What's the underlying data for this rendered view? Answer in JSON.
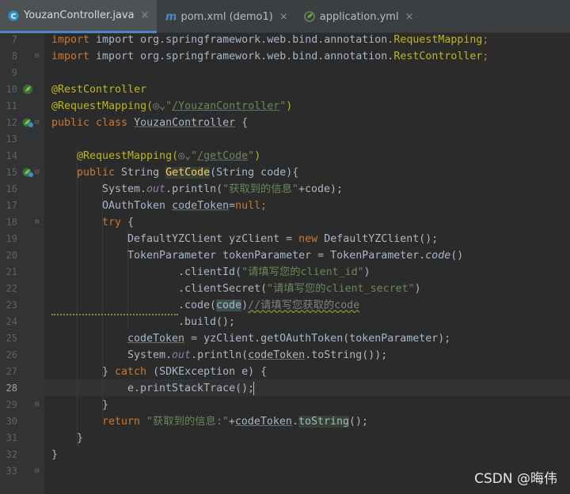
{
  "tabs": [
    {
      "label": "YouzanController.java",
      "icon": "java-class-icon",
      "active": true
    },
    {
      "label": "pom.xml (demo1)",
      "icon": "maven-icon",
      "active": false
    },
    {
      "label": "application.yml",
      "icon": "spring-config-icon",
      "active": false
    }
  ],
  "close_glyph": "×",
  "line_numbers": [
    "7",
    "8",
    "9",
    "10",
    "11",
    "12",
    "13",
    "14",
    "15",
    "16",
    "17",
    "18",
    "19",
    "20",
    "21",
    "22",
    "23",
    "24",
    "25",
    "26",
    "27",
    "28",
    "29",
    "30",
    "31",
    "32",
    "33"
  ],
  "current_line": "28",
  "code": {
    "l7": "import org.springframework.web.bind.annotation.",
    "l7b": "RequestMapping",
    "l7c": ";",
    "l8": "import org.springframework.web.bind.annotation.",
    "l8b": "RestController",
    "l8c": ";",
    "l10": "@RestController",
    "l11a": "@RequestMapping(",
    "l11b": "\"",
    "l11c": "/YouzanController",
    "l11d": "\"",
    "l11e": ")",
    "l12a": "public class ",
    "l12b": "YouzanController",
    "l12c": " {",
    "l14a": "@RequestMapping(",
    "l14b": "\"",
    "l14c": "/getCode",
    "l14d": "\"",
    "l14e": ")",
    "l15a": "public ",
    "l15b": "String ",
    "l15c": "GetCode",
    "l15d": "(String code){",
    "l16a": "System.",
    "l16b": "out",
    "l16c": ".println(",
    "l16d": "\"获取到的信息\"",
    "l16e": "+code);",
    "l17a": "OAuthToken ",
    "l17b": "codeToken",
    "l17c": "=",
    "l17d": "null",
    "l17e": ";",
    "l18a": "try",
    "l18b": " {",
    "l19a": "DefaultYZClient yzClient = ",
    "l19b": "new ",
    "l19c": "DefaultYZClient",
    "l19d": "();",
    "l20a": "TokenParameter tokenParameter = TokenParameter.",
    "l20b": "code",
    "l20c": "()",
    "l21a": ".clientId(",
    "l21b": "\"请填写您的client_id\"",
    "l21c": ")",
    "l22a": ".clientSecret(",
    "l22b": "\"请填写您的client_secret\"",
    "l22c": ")",
    "l23a": ".code(",
    "l23b": "code",
    "l23c": ")",
    "l23d": "//请填写您获取的code",
    "l24": ".build();",
    "l25a": "codeToken",
    "l25b": " = yzClient.getOAuthToken(tokenParameter);",
    "l26a": "System.",
    "l26b": "out",
    "l26c": ".println(",
    "l26d": "codeToken",
    "l26e": ".toString());",
    "l27a": "} ",
    "l27b": "catch ",
    "l27c": "(SDKException e) {",
    "l28": "e.printStackTrace();",
    "l29": "}",
    "l30a": "return ",
    "l30b": "\"获取到的信息:\"",
    "l30c": "+",
    "l30d": "codeToken",
    "l30e": ".",
    "l30f": "toString",
    "l30g": "();",
    "l31": "}",
    "l32": "}"
  },
  "watermark": "CSDN @晦伟",
  "colors": {
    "keyword": "#cc7832",
    "annotation": "#bbb529",
    "string": "#6a8759",
    "field": "#9876aa",
    "text": "#a9b7c6",
    "background": "#2b2b2b"
  }
}
